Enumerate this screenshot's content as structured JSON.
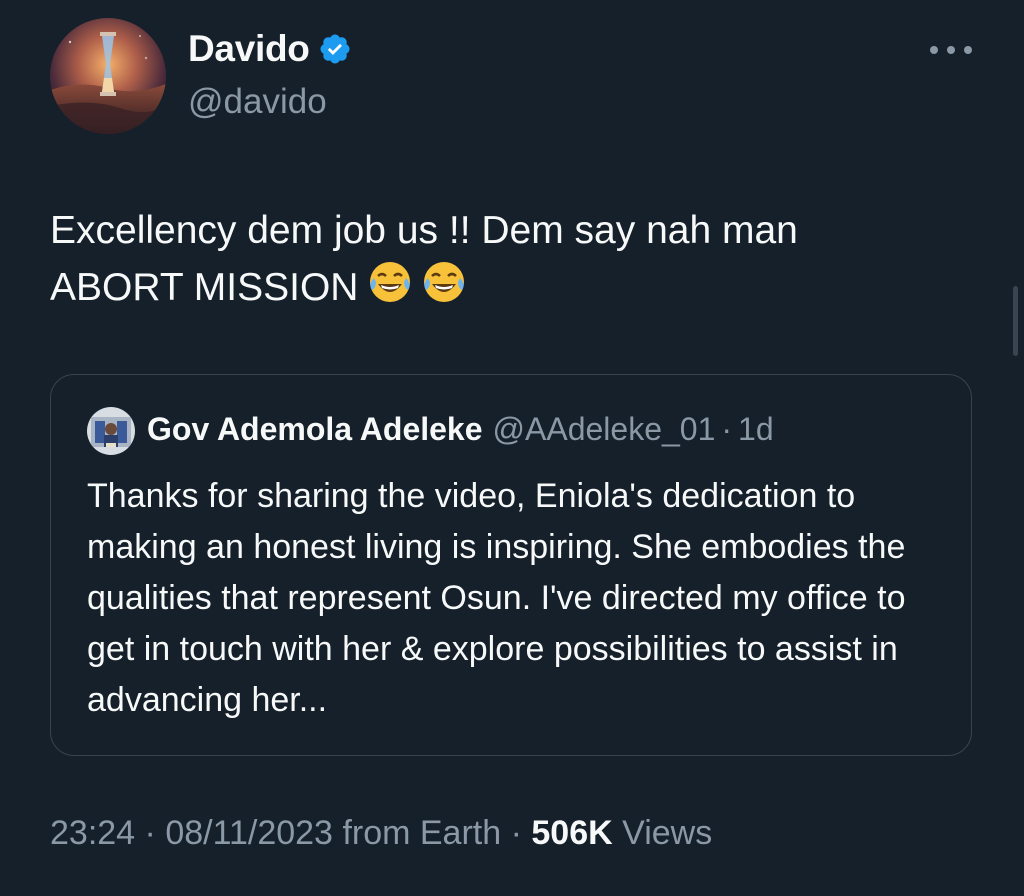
{
  "author": {
    "display_name": "Davido",
    "handle": "@davido",
    "verified": true
  },
  "tweet": {
    "text_line1": "Excellency dem job us !! Dem say nah man",
    "text_line2": "ABORT MISSION",
    "emojis": [
      "face-with-tears-of-joy-icon",
      "face-with-tears-of-joy-icon"
    ]
  },
  "quoted_tweet": {
    "display_name": "Gov Ademola Adeleke",
    "handle": "@AAdeleke_01",
    "separator": "·",
    "time": "1d",
    "text": "Thanks for sharing the video, Eniola's dedication to making an honest living is inspiring. She embodies the qualities that represent Osun. I've directed my office to get in touch with her & explore possibilities to assist in advancing her..."
  },
  "meta": {
    "time": "23:24",
    "separator": "·",
    "date": "08/11/2023",
    "source": "from Earth",
    "views_count": "506K",
    "views_label": "Views"
  },
  "colors": {
    "background": "#15202b",
    "text": "#f7f9f9",
    "secondary_text": "#8b98a5",
    "verified_blue": "#1d9bf0",
    "border": "#38444d"
  },
  "icons": {
    "more": "more-horizontal-icon",
    "verified": "verified-badge-icon"
  }
}
